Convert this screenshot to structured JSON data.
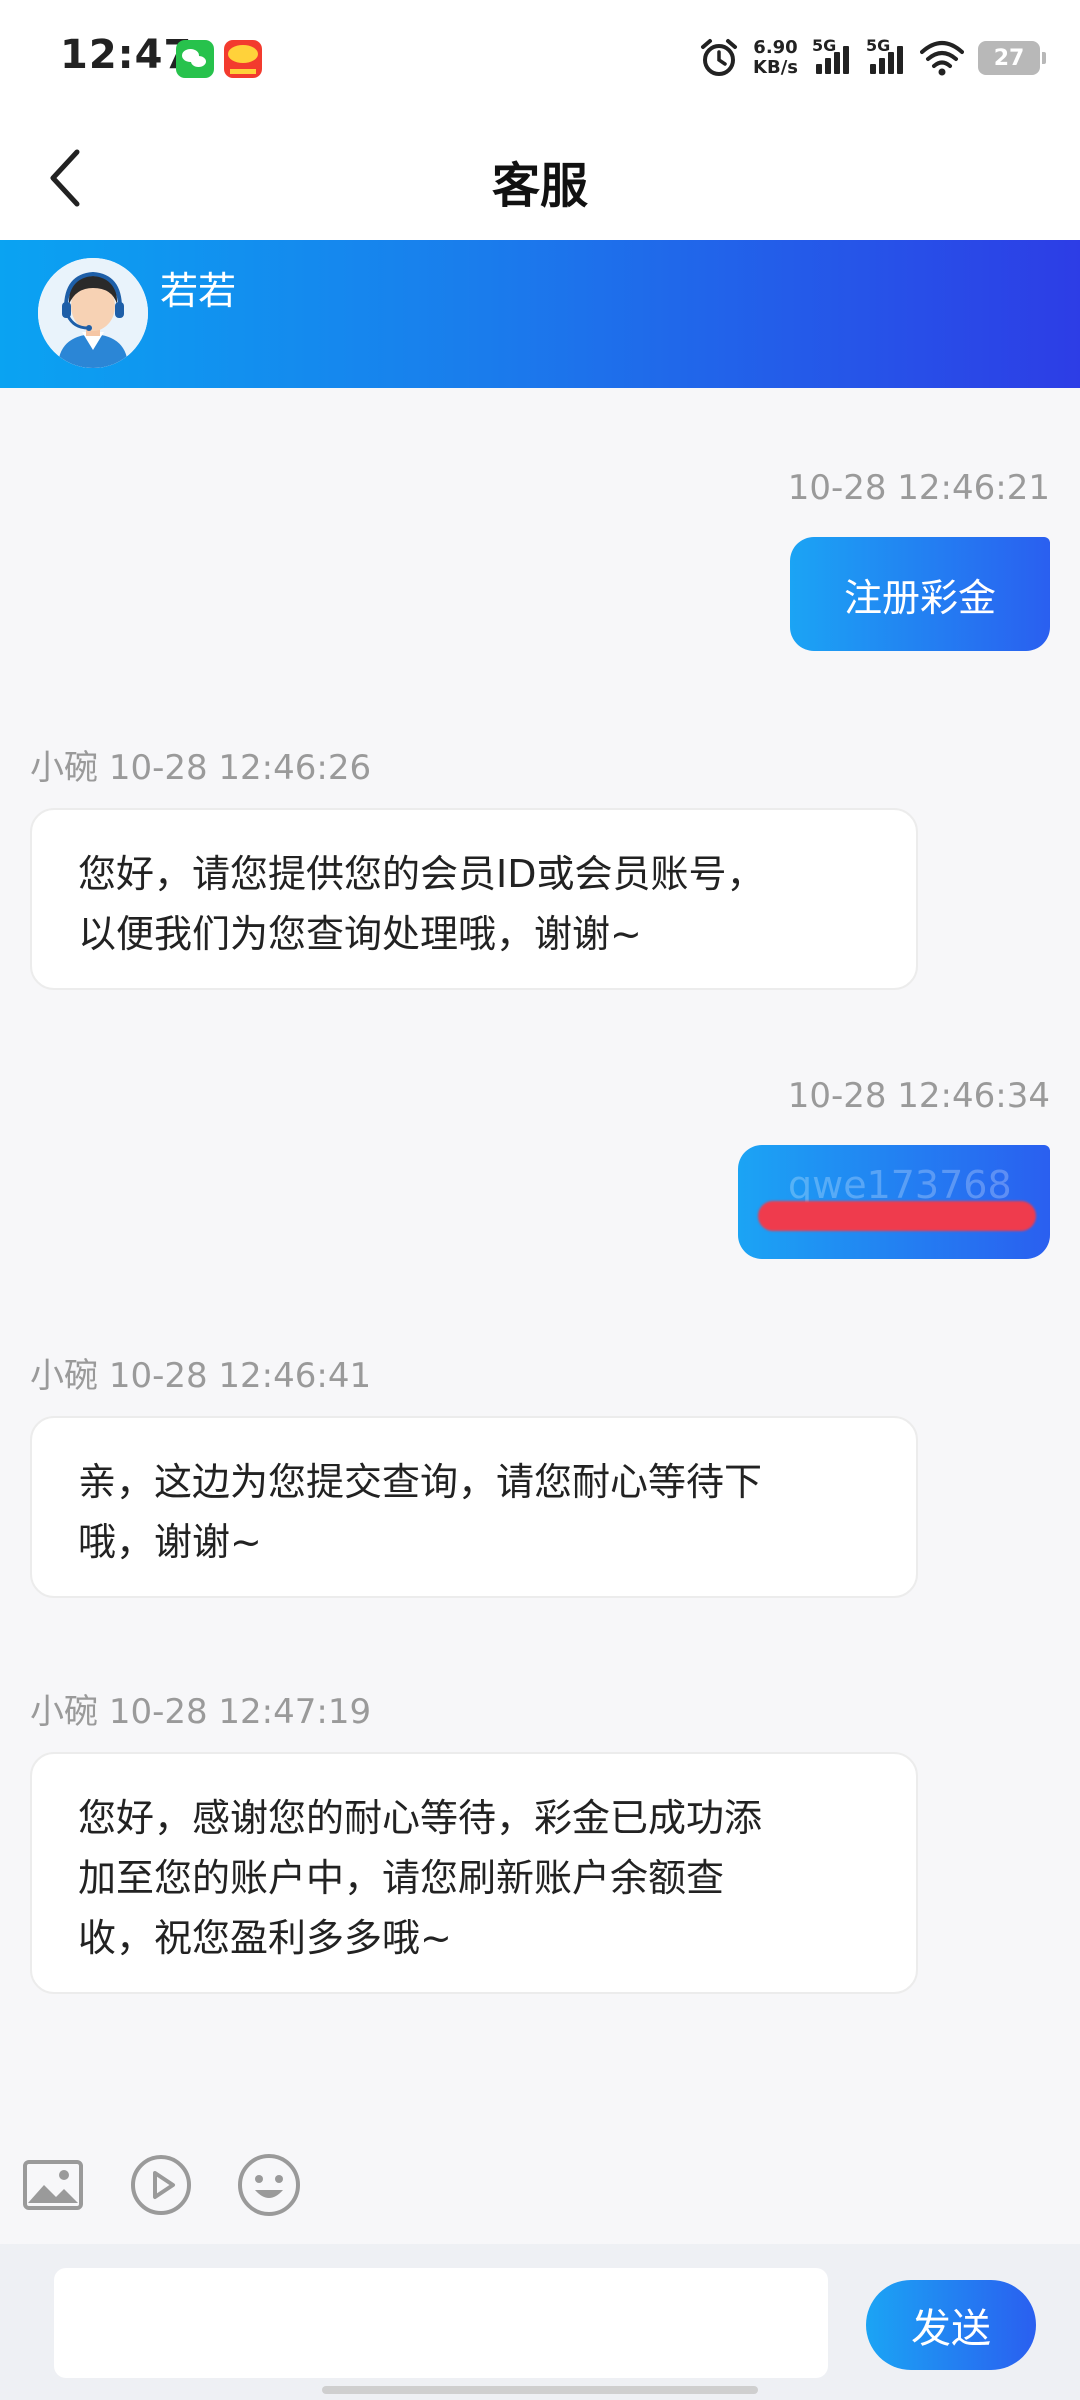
{
  "status_bar": {
    "time": "12:47",
    "net_speed_value": "6.90",
    "net_speed_unit": "KB/s",
    "signal1_label": "5G",
    "signal2_label": "5G",
    "battery": "27",
    "icons": [
      "wechat-icon",
      "app-notification-icon",
      "alarm-icon",
      "signal-icon",
      "wifi-icon",
      "battery-icon"
    ]
  },
  "header": {
    "title": "客服",
    "back_icon": "chevron-left-icon"
  },
  "agent": {
    "name": "若若",
    "avatar_icon": "support-agent-avatar-icon"
  },
  "messages": [
    {
      "direction": "out",
      "timestamp": "10-28 12:46:21",
      "text": "注册彩金"
    },
    {
      "direction": "in",
      "sender": "小碗",
      "timestamp": "10-28 12:46:26",
      "line1": "您好，请您提供您的会员ID或会员账号，",
      "line2": "以便我们为您查询处理哦，谢谢~"
    },
    {
      "direction": "out",
      "timestamp": "10-28 12:46:34",
      "text": "qwe173768",
      "redacted": true
    },
    {
      "direction": "in",
      "sender": "小碗",
      "timestamp": "10-28 12:46:41",
      "line1": "亲，这边为您提交查询，请您耐心等待下",
      "line2": "哦，谢谢~"
    },
    {
      "direction": "in",
      "sender": "小碗",
      "timestamp": "10-28 12:47:19",
      "line1": "您好，感谢您的耐心等待，彩金已成功添",
      "line2": "加至您的账户中，请您刷新账户余额查",
      "line3": "收，祝您盈利多多哦~"
    }
  ],
  "toolbar": {
    "icons": [
      "image-icon",
      "video-play-icon",
      "emoji-icon"
    ]
  },
  "composer": {
    "placeholder": "",
    "value": "",
    "send_label": "发送"
  },
  "colors": {
    "accent_start": "#0aa3f2",
    "accent_end": "#2d3de6",
    "bubble_out": "#1ba4f4",
    "redaction": "#ef3b4d"
  }
}
